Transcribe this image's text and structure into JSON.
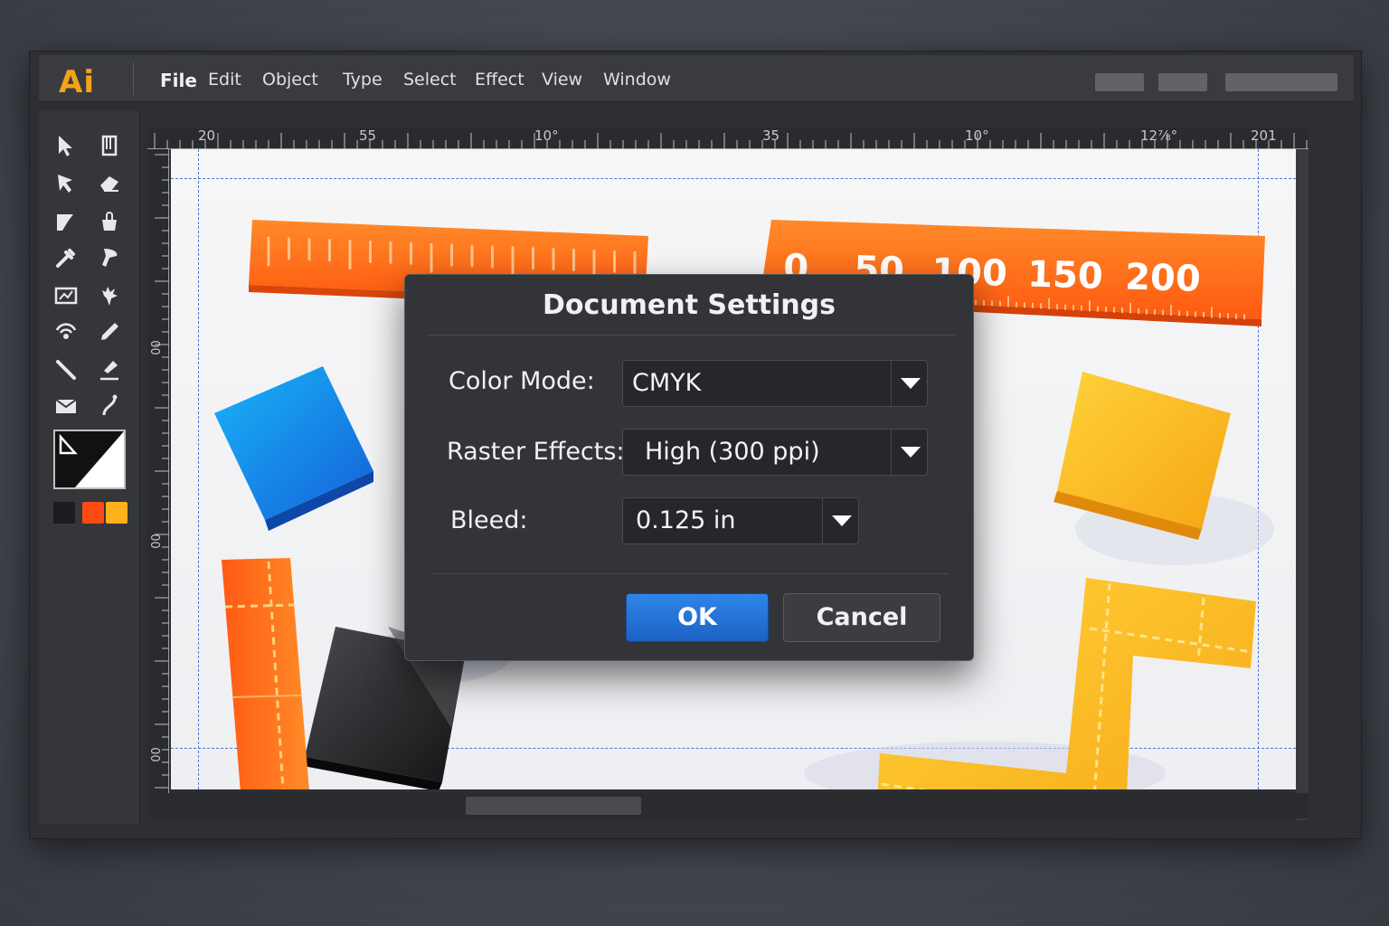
{
  "app": {
    "logo": "Ai",
    "menu": [
      "File",
      "Edit",
      "Object",
      "Type",
      "Select",
      "Effect",
      "View",
      "Window"
    ]
  },
  "rulers": {
    "horizontal": [
      "20",
      "55",
      "10°",
      "35",
      "10°",
      "12⅞°",
      "201"
    ],
    "vertical": [
      "00",
      "00",
      "00"
    ]
  },
  "canvas": {
    "ruler_object_labels": [
      "0",
      "50",
      "100",
      "150",
      "200"
    ],
    "colors": {
      "orange": "#ff6a1a",
      "blue": "#1e88f0",
      "yellow": "#fcc02a",
      "black": "#1c1c1e"
    }
  },
  "swatches": [
    "#1c1c1e",
    "#ff4a14",
    "#ffb21a"
  ],
  "dialog": {
    "title": "Document Settings",
    "color_mode": {
      "label": "Color Mode:",
      "value": "CMYK"
    },
    "raster_effects": {
      "label": "Raster Effects:",
      "value": "High (300 ppi)"
    },
    "bleed": {
      "label": "Bleed:",
      "value": "0.125 in"
    },
    "ok_label": "OK",
    "cancel_label": "Cancel"
  }
}
